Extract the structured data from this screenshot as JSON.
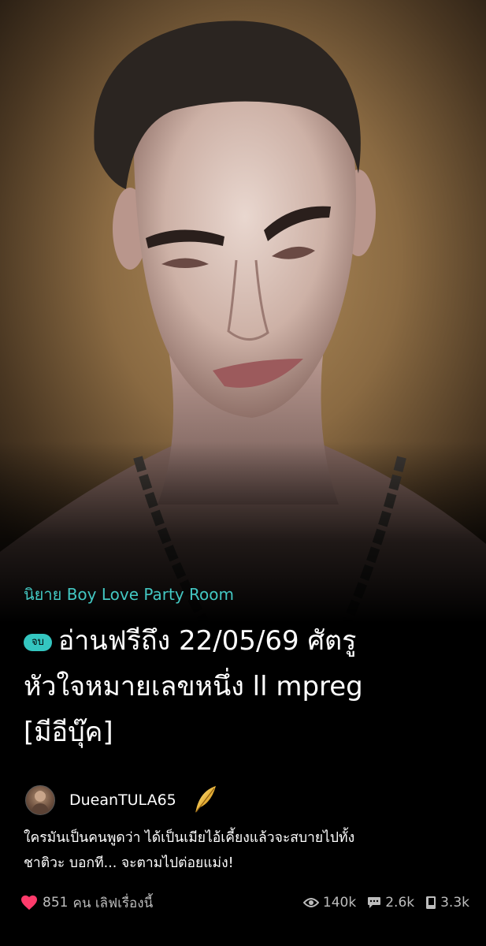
{
  "category": "นิยาย Boy Love Party Room",
  "badge": "จบ",
  "title_line1": "อ่านฟรีถึง 22/05/69 ศัตรู",
  "title_line2": "หัวใจหมายเลขหนึ่ง ll mpreg",
  "title_line3": "[มีอีบุ๊ค]",
  "author": {
    "name": "DueanTULA65",
    "avatar_icon": "avatar",
    "badge_icon": "quill-feather-icon"
  },
  "synopsis_line1": "ใครมันเป็นคนพูดว่า ได้เป็นเมียไอ้เคี้ยงแล้วจะสบายไปทั้ง",
  "synopsis_line2": "ชาติวะ บอกที... จะตามไปต่อยแม่ง!",
  "stats": {
    "love_count": "851",
    "love_label": "คน เลิฟเรื่องนี้",
    "views": "140k",
    "comments": "2.6k",
    "chapters": "3.3k"
  },
  "colors": {
    "accent": "#34c6c0",
    "heart": "#ff3b6b",
    "background": "#000000"
  }
}
